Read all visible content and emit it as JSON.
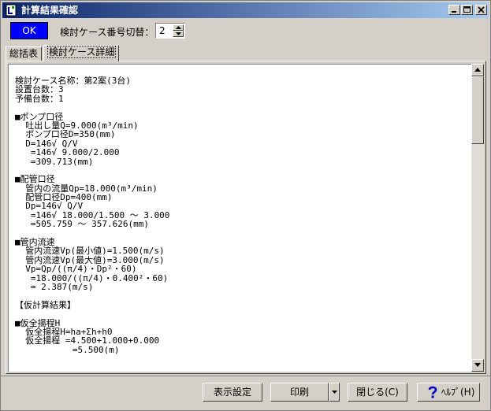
{
  "window": {
    "title": "計算結果確認"
  },
  "toolbar": {
    "ok_label": "OK",
    "case_switch_label": "検討ケース番号切替：",
    "case_number": "2"
  },
  "tabs": [
    {
      "label": "総括表"
    },
    {
      "label": "検討ケース詳細"
    }
  ],
  "content": {
    "lines": [
      "検討ケース名称：第2案(3台)",
      "設置台数：3",
      "予備台数：1",
      "",
      "■ポンプ口径",
      "  吐出し量Q=9.000(m³/min)",
      "  ポンプ口径D=350(mm)",
      "  D=146√ Q/V",
      "   =146√ 9.000/2.000",
      "   =309.713(mm)",
      "",
      "■配管口径",
      "  管内の流量Qp=18.000(m³/min)",
      "  配管口径Dp=400(mm)",
      "  Dp=146√ Q/V",
      "   =146√ 18.000/1.500 ～ 3.000",
      "   =505.759 ～ 357.626(mm)",
      "",
      "■管内流速",
      "  管内流速Vp(最小値)=1.500(m/s)",
      "  管内流速Vp(最大値)=3.000(m/s)",
      "  Vp=Qp/((π/4)・Dp²・60)",
      "   =18.000/((π/4)・0.400²・60)",
      "   = 2.387(m/s)",
      "",
      "【仮計算結果】",
      "",
      "■仮全揚程H",
      "  仮全揚程H=ha+Σh+h0",
      "  仮全揚程 =4.500+1.000+0.000",
      "           =5.500(m)"
    ]
  },
  "buttons": {
    "display_settings": "表示設定",
    "print": "印刷",
    "close": "閉じる(C)",
    "help": "ﾍﾙﾌﾟ(H)"
  },
  "colors": {
    "ok_button": "#0000ff",
    "titlebar_start": "#0a246a",
    "titlebar_end": "#a6caf0"
  }
}
